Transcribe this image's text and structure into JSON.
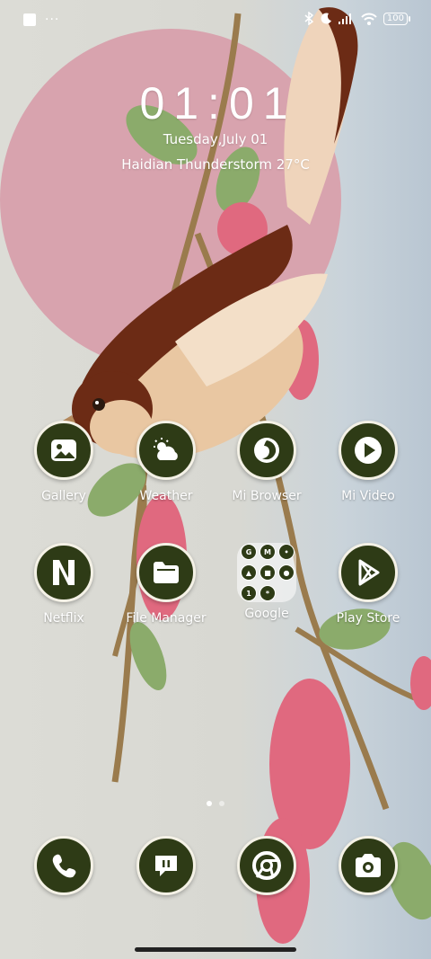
{
  "status_bar": {
    "left_icons": [
      "notification-square-icon",
      "more-dots-icon"
    ],
    "right_icons": [
      "bluetooth-icon",
      "moon-icon",
      "signal-icon",
      "wifi-icon",
      "battery-icon"
    ],
    "battery": "100"
  },
  "clock": {
    "time": "01:01",
    "date": "Tuesday,July 01",
    "weather": "Haidian Thunderstorm 27°C"
  },
  "apps_row1": [
    {
      "label": "Gallery",
      "icon": "gallery-icon"
    },
    {
      "label": "Weather",
      "icon": "weather-icon"
    },
    {
      "label": "Mi Browser",
      "icon": "browser-icon"
    },
    {
      "label": "Mi Video",
      "icon": "play-icon"
    }
  ],
  "apps_row2": [
    {
      "label": "Netflix",
      "icon": "netflix-icon"
    },
    {
      "label": "File Manager",
      "icon": "folder-icon"
    },
    {
      "label": "Google",
      "icon": "google-folder-icon"
    },
    {
      "label": "Play Store",
      "icon": "play-store-icon"
    }
  ],
  "google_folder": [
    "G",
    "M",
    "",
    "",
    "",
    "",
    "1",
    "*"
  ],
  "dock": [
    {
      "icon": "phone-icon"
    },
    {
      "icon": "messages-icon"
    },
    {
      "icon": "chrome-icon"
    },
    {
      "icon": "camera-icon"
    }
  ],
  "pager": {
    "pages": 2,
    "active": 1
  },
  "colors": {
    "icon_bg": "#2e3b16",
    "icon_ring": "#f4f1e6",
    "wallpaper_circle": "#d8a3ae"
  }
}
